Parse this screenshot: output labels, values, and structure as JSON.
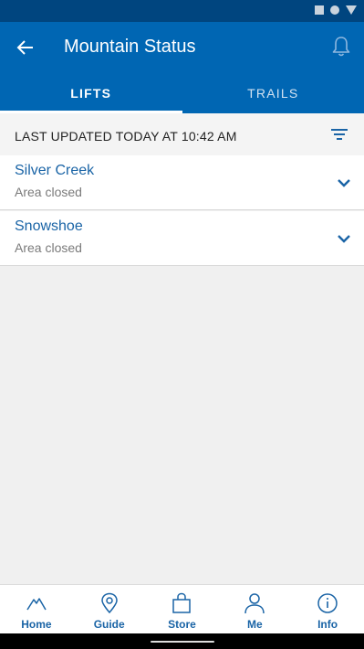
{
  "app": {
    "title": "Mountain Status"
  },
  "tabs": [
    {
      "label": "LIFTS",
      "active": true
    },
    {
      "label": "TRAILS",
      "active": false
    }
  ],
  "updated": {
    "text": "LAST UPDATED TODAY AT 10:42 AM"
  },
  "areas": [
    {
      "name": "Silver Creek",
      "status": "Area closed"
    },
    {
      "name": "Snowshoe",
      "status": "Area closed"
    }
  ],
  "nav": [
    {
      "label": "Home",
      "icon": "mountain-icon"
    },
    {
      "label": "Guide",
      "icon": "map-pin-icon"
    },
    {
      "label": "Store",
      "icon": "shopping-bag-icon"
    },
    {
      "label": "Me",
      "icon": "person-icon"
    },
    {
      "label": "Info",
      "icon": "info-icon"
    }
  ],
  "colors": {
    "status_bar": "#00457f",
    "app_bar": "#0066b3",
    "accent": "#1a64a6",
    "background": "#f0f0f0"
  }
}
